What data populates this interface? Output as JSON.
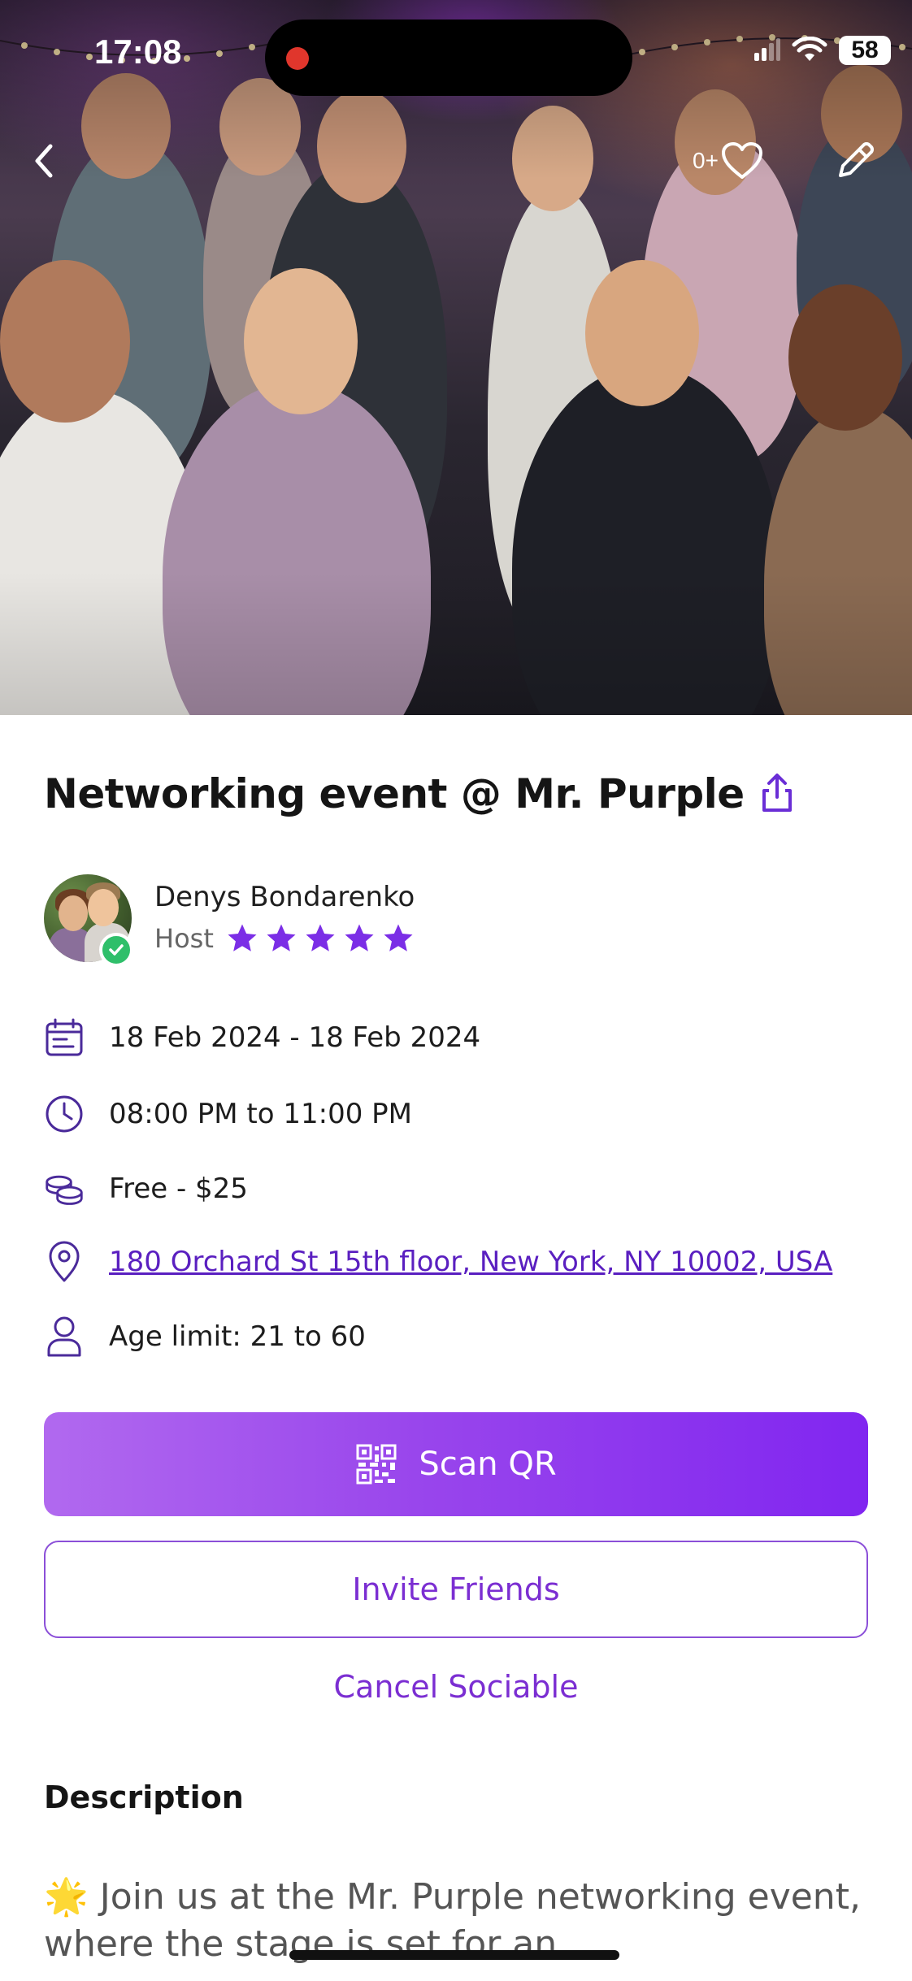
{
  "status_bar": {
    "time": "17:08",
    "battery": "58"
  },
  "hero": {
    "like_count": "0+"
  },
  "event": {
    "title": "Networking event @ Mr. Purple"
  },
  "host": {
    "name": "Denys Bondarenko",
    "role": "Host",
    "rating": 5,
    "rating_max": 5
  },
  "details": {
    "date": "18 Feb 2024 - 18 Feb 2024",
    "time": "08:00 PM to 11:00 PM",
    "price": "Free - $25",
    "address": "180 Orchard St 15th floor, New York, NY 10002, USA",
    "age_limit": "Age limit: 21 to 60"
  },
  "actions": {
    "scan_qr": "Scan QR",
    "invite_friends": "Invite Friends",
    "cancel": "Cancel Sociable"
  },
  "description": {
    "heading": "Description",
    "emoji": "🌟",
    "text": "Join us at the Mr. Purple networking event, where the stage is set for an"
  },
  "colors": {
    "accent": "#8126f0",
    "accent_light": "#b169ef",
    "link": "#5a1fc0",
    "verified": "#2fbf6a"
  },
  "icons": [
    "back-icon",
    "heart-icon",
    "edit-icon",
    "share-icon",
    "calendar-icon",
    "clock-icon",
    "coins-icon",
    "location-pin-icon",
    "user-icon",
    "qr-code-icon",
    "star-icon",
    "checkmark-icon"
  ]
}
